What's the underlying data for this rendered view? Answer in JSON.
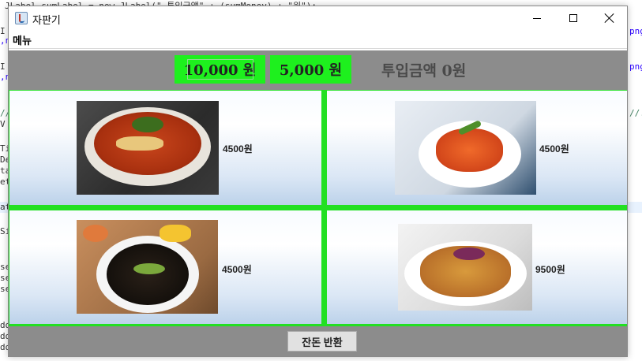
{
  "background_code": {
    "lines": [
      "JLabel sumLabel = new JLabel(\"     투입금액\" + (sumMoney) + \"원\");",
      "I",
      ",n",
      "I",
      ",n",
      "//",
      " V",
      "Ti",
      "De",
      "ta",
      "et",
      "at",
      "Si",
      "se",
      "se",
      "se",
      "dd",
      "dd",
      "dd"
    ],
    "right_fragments": [
      "png",
      "png",
      "//."
    ]
  },
  "window": {
    "title": "자판기",
    "icon": "java-cup-icon"
  },
  "menu": {
    "label": "메뉴"
  },
  "coins": {
    "bill_10000": "10,000 원",
    "bill_5000": "5,000 원",
    "inserted_label": "투입금액 0원"
  },
  "items": [
    {
      "picture": "jjamppong-photo",
      "price": "4500원"
    },
    {
      "picture": "kkanpunggi-photo",
      "price": "4500원"
    },
    {
      "picture": "jajangmyeon-photo",
      "price": "4500원"
    },
    {
      "picture": "tangsuyuk-photo",
      "price": "9500원"
    }
  ],
  "change_button": "잔돈 반환",
  "colors": {
    "accent_green": "#1ef01e",
    "panel_gray": "#8c8c8c"
  }
}
